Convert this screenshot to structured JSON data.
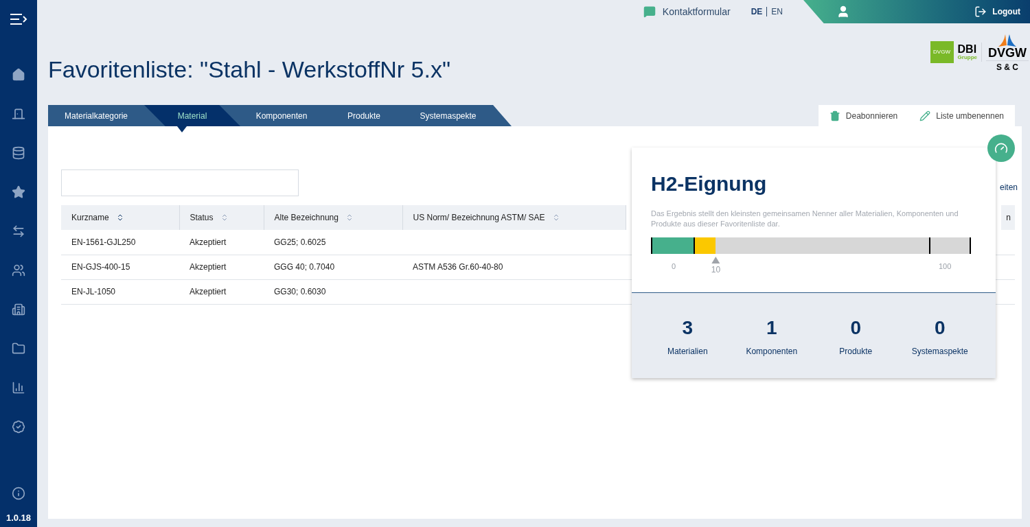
{
  "sidebar": {
    "items": [
      {
        "kind": "home"
      },
      {
        "kind": "door"
      },
      {
        "kind": "database"
      },
      {
        "kind": "star"
      },
      {
        "kind": "swap"
      },
      {
        "kind": "people"
      },
      {
        "kind": "building"
      },
      {
        "kind": "folder"
      },
      {
        "kind": "chart"
      },
      {
        "kind": "badge"
      },
      {
        "kind": "info"
      }
    ],
    "version": "1.0.18"
  },
  "topbar": {
    "contact": "Kontaktformular",
    "languages": [
      {
        "label": "DE",
        "selected": true
      },
      {
        "label": "EN",
        "selected": false
      }
    ],
    "logout": "Logout"
  },
  "title": "Favoritenliste: \"Stahl - WerkstoffNr 5.x\"",
  "logo": {
    "small": "DVGW",
    "dbi": "DBI",
    "gruppe": "Gruppe",
    "dvgw": "DVGW",
    "sc": "S & C"
  },
  "tabs": [
    {
      "label": "Materialkategorie",
      "selected": false
    },
    {
      "label": "Material",
      "selected": true
    },
    {
      "label": "Komponenten",
      "selected": false
    },
    {
      "label": "Produkte",
      "selected": false
    },
    {
      "label": "Systemaspekte",
      "selected": false
    }
  ],
  "actions": [
    "Deabonnieren",
    "Liste umbenennen"
  ],
  "cut_link": "eiten",
  "table": {
    "columns": [
      {
        "label": "Kurzname",
        "sorted": true
      },
      {
        "label": "Status",
        "sorted": false
      },
      {
        "label": "Alte Bezeichnung",
        "sorted": false
      },
      {
        "label": "US Norm/ Bezeichnung ASTM/ SAE",
        "sorted": false
      }
    ],
    "column_5": "n",
    "rows": [
      [
        "EN-1561-GJL250",
        "Akzeptiert",
        "GG25; 0.6025",
        ""
      ],
      [
        "EN-GJS-400-15",
        "Akzeptiert",
        "GGG 40; 0.7040",
        "ASTM A536 Gr.60-40-80"
      ],
      [
        "EN-JL-1050",
        "Akzeptiert",
        "GG30; 0.6030",
        ""
      ]
    ]
  },
  "popup": {
    "title": "H2-Eignung",
    "description": "Das Ergebnis stellt den kleinsten gemeinsamen Nenner aller Materialien, Komponenten und Produkte aus dieser Favoritenliste dar.",
    "scale": {
      "level": 0.2,
      "min": "0",
      "marker": "10",
      "max": "100"
    },
    "stats": [
      {
        "value": "3",
        "label": "Materialien"
      },
      {
        "value": "1",
        "label": "Komponenten"
      },
      {
        "value": "0",
        "label": "Produkte"
      },
      {
        "value": "0",
        "label": "Systemaspekte"
      }
    ]
  }
}
